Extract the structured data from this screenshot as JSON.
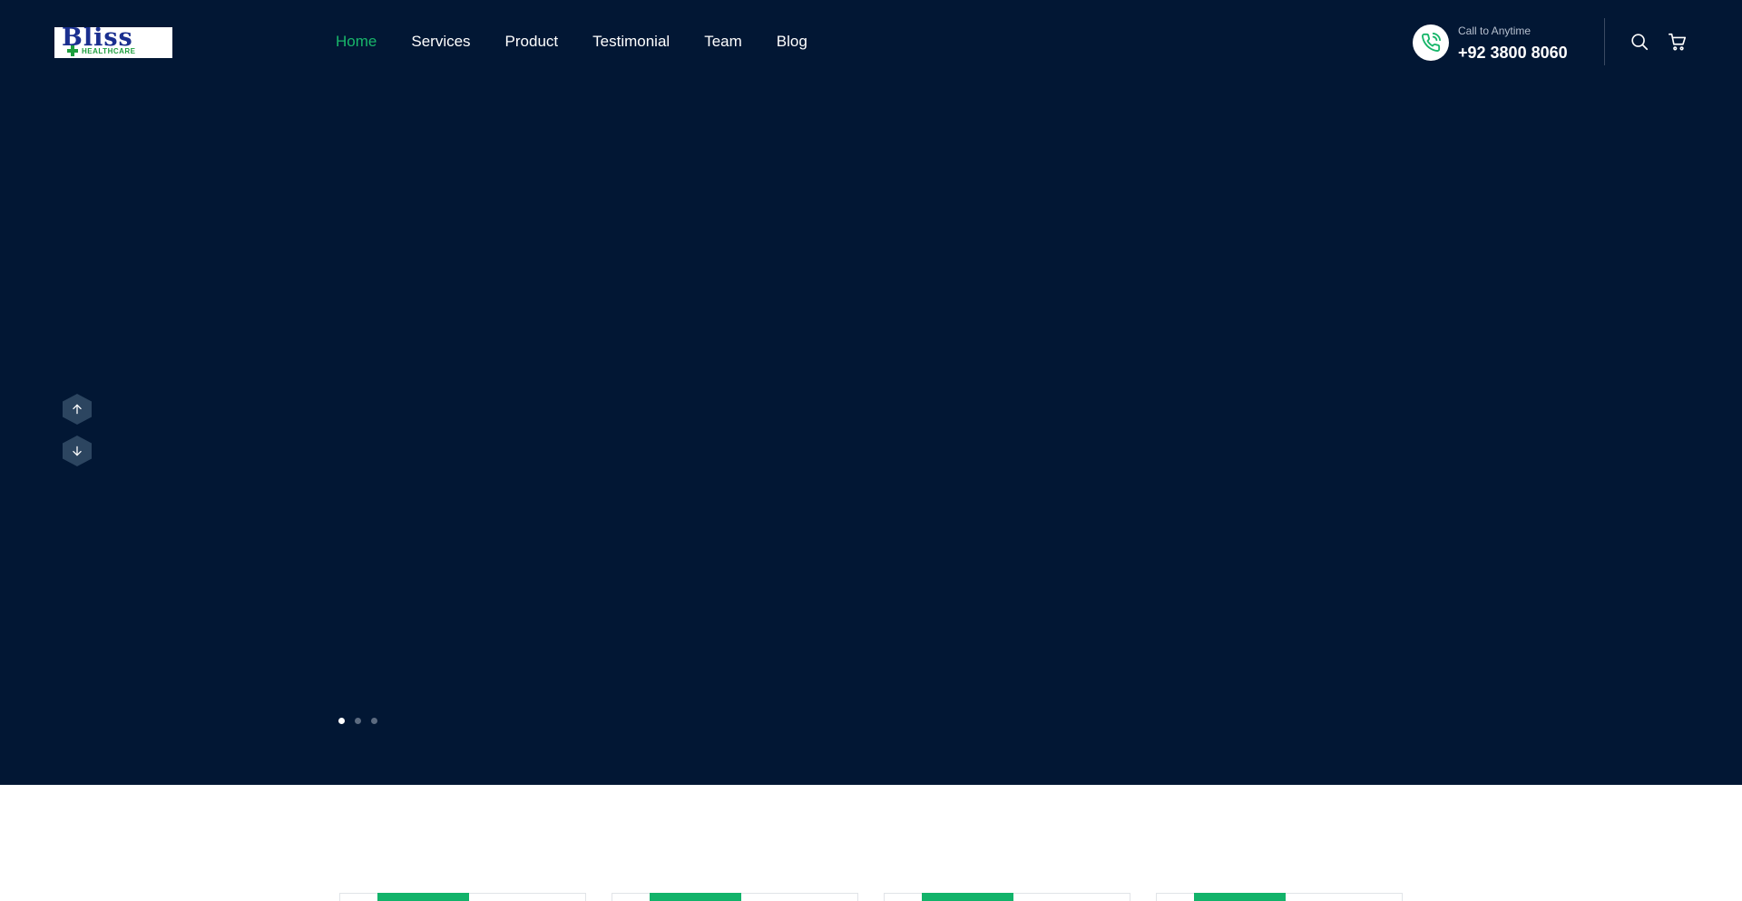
{
  "brand": {
    "logo_word": "Bliss",
    "logo_sub": "HEALTHCARE"
  },
  "nav": {
    "items": [
      {
        "label": "Home",
        "active": true
      },
      {
        "label": "Services",
        "active": false
      },
      {
        "label": "Product",
        "active": false
      },
      {
        "label": "Testimonial",
        "active": false
      },
      {
        "label": "Team",
        "active": false
      },
      {
        "label": "Blog",
        "active": false
      }
    ]
  },
  "contact": {
    "label": "Call to Anytime",
    "number": "+92 3800 8060"
  },
  "header_icons": [
    "phone-icon",
    "search-icon",
    "cart-icon"
  ],
  "slider": {
    "slide_count": 3,
    "active_index": 0,
    "controls": [
      "arrow-up-icon",
      "arrow-down-icon"
    ]
  },
  "cards": {
    "count": 4
  },
  "colors": {
    "hero_bg": "#021734",
    "accent": "#18b66a",
    "text": "#ffffff",
    "arrow_bg": "#2c4560"
  }
}
